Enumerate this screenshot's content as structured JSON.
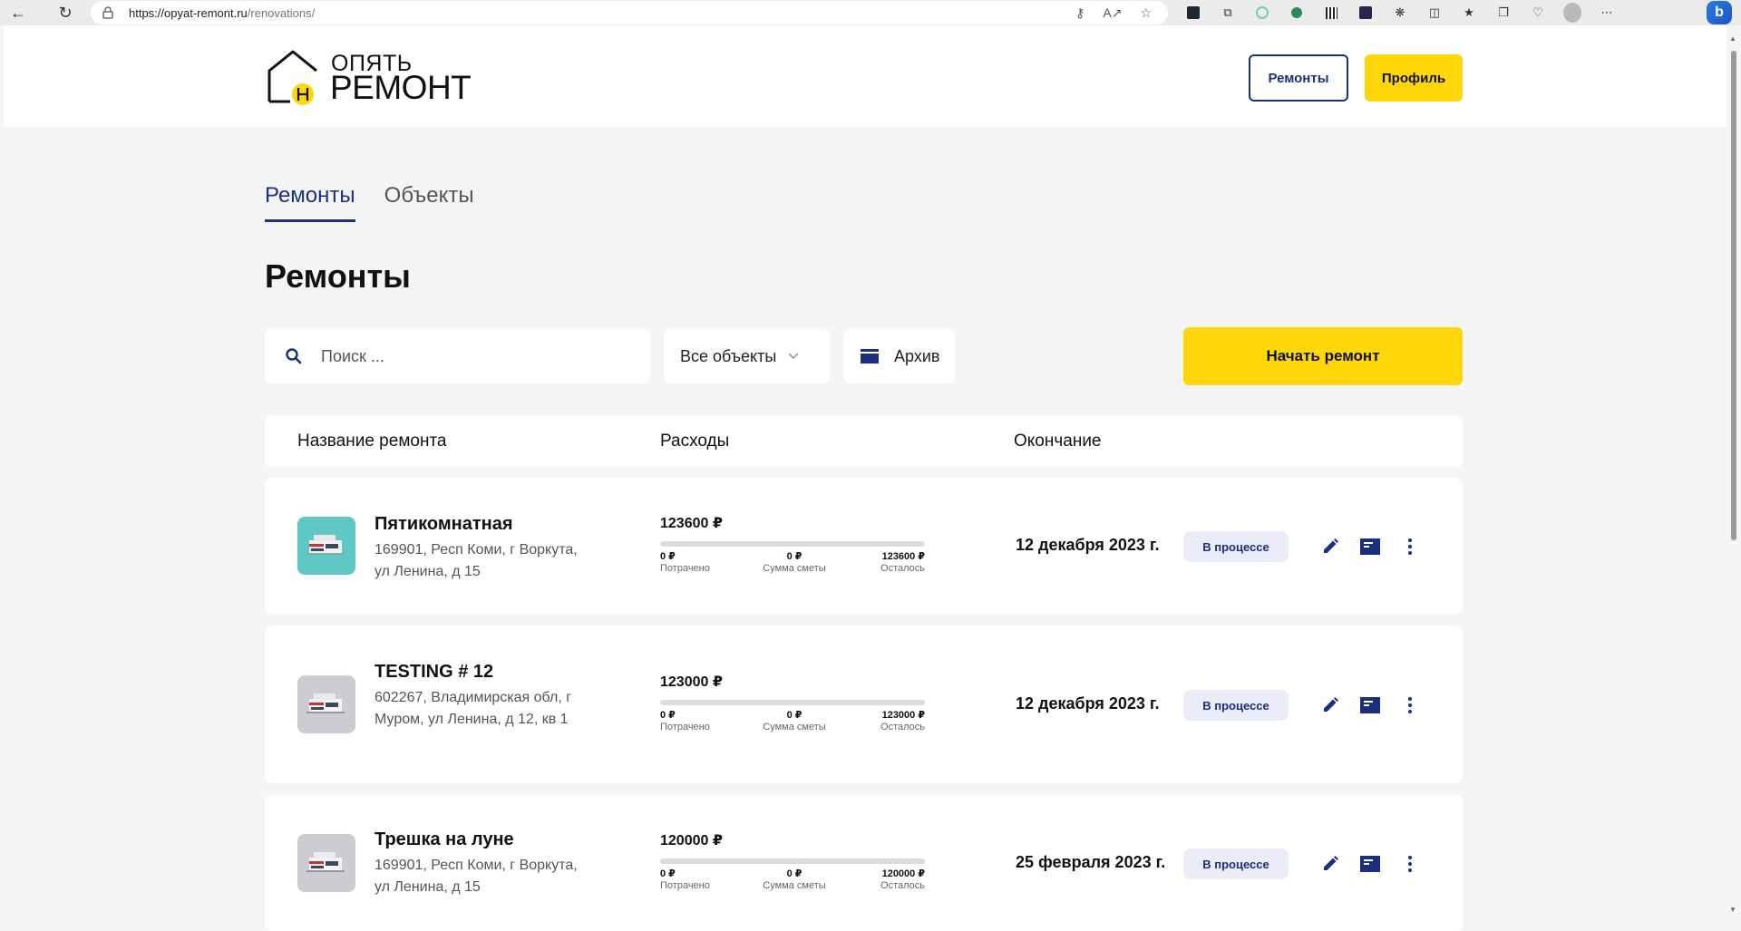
{
  "browser": {
    "url_host": "https://opyat-remont.ru",
    "url_path": "/renovations/"
  },
  "header": {
    "logo_top": "ОПЯТЬ",
    "logo_main": "РЕМОНТ",
    "renovations_button": "Ремонты",
    "profile_button": "Профиль"
  },
  "tabs": [
    "Ремонты",
    "Объекты"
  ],
  "page_title": "Ремонты",
  "toolbar": {
    "search_placeholder": "Поиск ...",
    "objects_filter": "Все объекты",
    "archive_label": "Архив",
    "start_button": "Начать ремонт"
  },
  "table": {
    "headers": [
      "Название ремонта",
      "Расходы",
      "Окончание"
    ],
    "stat_labels": {
      "spent": "Потрачено",
      "estimate": "Сумма сметы",
      "remaining": "Осталось"
    },
    "rows": [
      {
        "title": "Пятикомнатная",
        "address": "169901, Респ Коми, г Воркута, ул Ленина, д 15",
        "amount": "123600 ₽",
        "spent": "0 ₽",
        "estimate": "0 ₽",
        "remaining": "123600 ₽",
        "progress": 0,
        "end_date": "12 декабря 2023 г.",
        "status": "В процессе",
        "thumb_color": "#5fc8c4"
      },
      {
        "title": "TESTING # 12",
        "address": "602267, Владимирская обл, г Муром, ул Ленина, д 12, кв 1",
        "amount": "123000 ₽",
        "spent": "0 ₽",
        "estimate": "0 ₽",
        "remaining": "123000 ₽",
        "progress": 0,
        "end_date": "12 декабря 2023 г.",
        "status": "В процессе",
        "thumb_color": "#cfcbd3"
      },
      {
        "title": "Трешка на луне",
        "address": "169901, Респ Коми, г Воркута, ул Ленина, д 15",
        "amount": "120000 ₽",
        "spent": "0 ₽",
        "estimate": "0 ₽",
        "remaining": "120000 ₽",
        "progress": 0,
        "end_date": "25 февраля 2023 г.",
        "status": "В процессе",
        "thumb_color": "#cfcbd3"
      }
    ]
  },
  "colors": {
    "brand_blue": "#1b2f7e",
    "brand_yellow": "#ffd60a",
    "badge_bg": "#eaedf7"
  }
}
